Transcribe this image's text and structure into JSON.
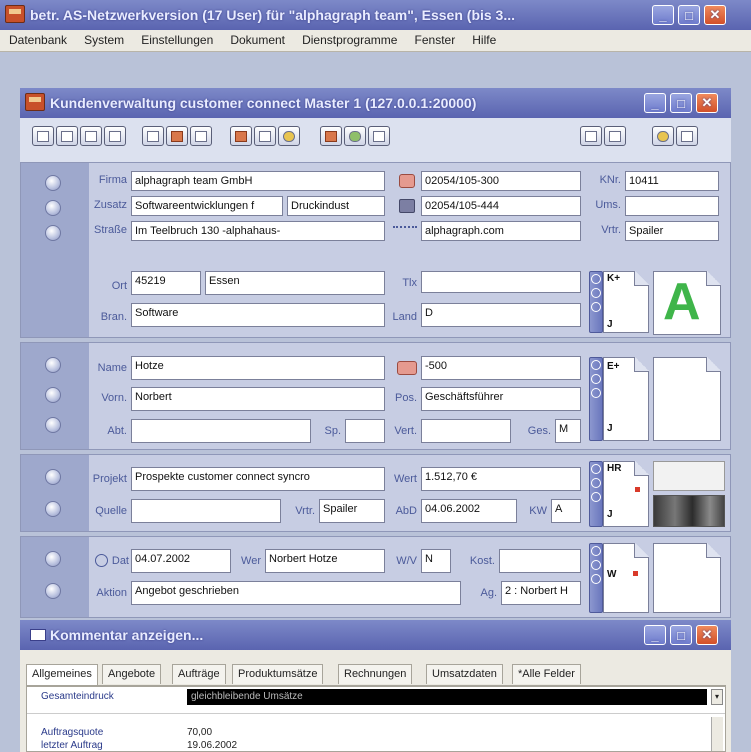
{
  "main_window": {
    "title": "betr. AS-Netzwerkversion (17 User) für \"alphagraph team\", Essen (bis 3..."
  },
  "menu": [
    "Datenbank",
    "System",
    "Einstellungen",
    "Dokument",
    "Dienstprogramme",
    "Fenster",
    "Hilfe"
  ],
  "crm_window": {
    "title": "Kundenverwaltung customer connect Master 1 (127.0.0.1:20000)"
  },
  "company": {
    "firma_label": "Firma",
    "firma": "alphagraph team GmbH",
    "zusatz_label": "Zusatz",
    "zusatz": "Softwareentwicklungen f",
    "zusatz2": "Druckindust",
    "strasse_label": "Straße",
    "strasse": "Im Teelbruch 130 -alphahaus-",
    "ort_label": "Ort",
    "plz": "45219",
    "ort": "Essen",
    "bran_label": "Bran.",
    "bran": "Software",
    "phone": "02054/105-300",
    "fax": "02054/105-444",
    "web": "alphagraph.com",
    "tlx_label": "Tlx",
    "tlx": "",
    "land_label": "Land",
    "land": "D",
    "knr_label": "KNr.",
    "knr": "10411",
    "ums_label": "Ums.",
    "ums": "",
    "vrt_label": "Vrtr.",
    "vrt": "Spailer",
    "card_letter_top": "K+",
    "card_letter_bottom": "J",
    "card_big_letter": "A"
  },
  "contact": {
    "name_label": "Name",
    "name": "Hotze",
    "vorn_label": "Vorn.",
    "vorn": "Norbert",
    "abt_label": "Abt.",
    "abt": "",
    "sp_label": "Sp.",
    "sp": "",
    "ext": "-500",
    "pos_label": "Pos.",
    "pos": "Geschäftsführer",
    "vert_label": "Vert.",
    "vert": "",
    "ges_label": "Ges.",
    "ges": "M",
    "card_letter_top": "E+",
    "card_letter_bottom": "J"
  },
  "project": {
    "projekt_label": "Projekt",
    "projekt": "Prospekte customer connect syncro",
    "quelle_label": "Quelle",
    "quelle": "",
    "vrtr_label": "Vrtr.",
    "vrtr": "Spailer",
    "wert_label": "Wert",
    "wert": "1.512,70 €",
    "abd_label": "AbD",
    "abd": "04.06.2002",
    "kw_label": "KW",
    "kw": "A",
    "card_letter_top": "HR",
    "card_letter_bottom": "J"
  },
  "action": {
    "dat_label": "Dat",
    "dat": "04.07.2002",
    "wer_label": "Wer",
    "wer": "Norbert Hotze",
    "wv_label": "W/V",
    "wv": "N",
    "kost_label": "Kost.",
    "kost": "",
    "aktion_label": "Aktion",
    "aktion": "Angebot geschrieben",
    "ag_label": "Ag.",
    "ag": "2 : Norbert H",
    "card_letter_top": "W"
  },
  "comments_window": {
    "title": "Kommentar anzeigen...",
    "tabs": [
      "Allgemeines",
      "Angebote",
      "Aufträge",
      "Produktumsätze",
      "Rechnungen",
      "Umsatzdaten",
      "*Alle Felder"
    ],
    "row1_label": "Gesamteindruck",
    "row1_value": "gleichbleibende Umsätze",
    "row2_label": "Auftragsquote",
    "row2_value": "70,00",
    "row3_label": "letzter Auftrag",
    "row3_value": "19.06.2002"
  },
  "colors": {
    "accent": "#6a72c0",
    "close": "#d2502a"
  }
}
